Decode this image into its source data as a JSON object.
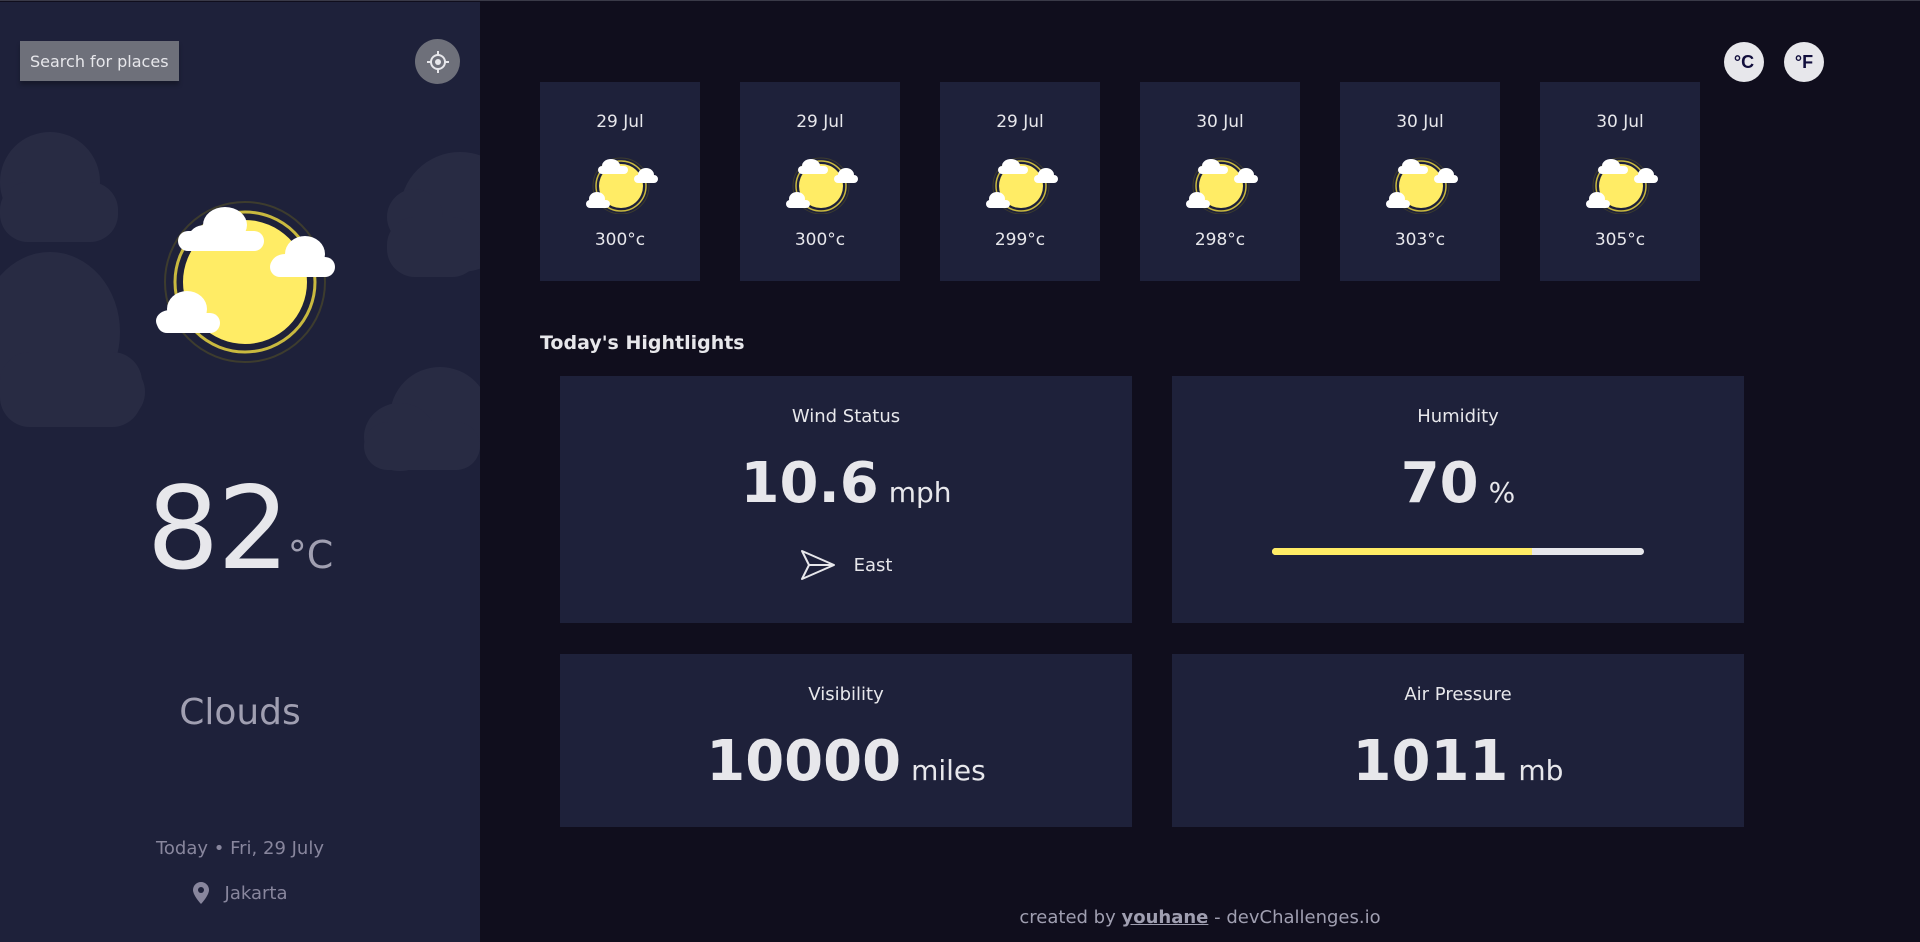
{
  "sidebar": {
    "search_label": "Search for places",
    "temperature": "82",
    "temperature_unit": "°C",
    "weather": "Clouds",
    "date": "Today • Fri, 29 July",
    "location": "Jakarta"
  },
  "units": {
    "celsius": "°C",
    "fahrenheit": "°F"
  },
  "forecast": [
    {
      "date": "29 Jul",
      "temp": "300°c",
      "icon": "partly-cloudy-sun-icon"
    },
    {
      "date": "29 Jul",
      "temp": "300°c",
      "icon": "partly-cloudy-sun-icon"
    },
    {
      "date": "29 Jul",
      "temp": "299°c",
      "icon": "partly-cloudy-sun-icon"
    },
    {
      "date": "30 Jul",
      "temp": "298°c",
      "icon": "partly-cloudy-sun-icon"
    },
    {
      "date": "30 Jul",
      "temp": "303°c",
      "icon": "partly-cloudy-sun-icon"
    },
    {
      "date": "30 Jul",
      "temp": "305°c",
      "icon": "partly-cloudy-sun-icon"
    }
  ],
  "highlights": {
    "title": "Today's Hightlights",
    "wind": {
      "title": "Wind Status",
      "value": "10.6",
      "unit": "mph",
      "direction": "East"
    },
    "humidity": {
      "title": "Humidity",
      "value": "70",
      "unit": "%",
      "percent": 70
    },
    "visibility": {
      "title": "Visibility",
      "value": "10000",
      "unit": "miles"
    },
    "pressure": {
      "title": "Air Pressure",
      "value": "1011",
      "unit": "mb"
    }
  },
  "footer": {
    "prefix": "created by",
    "author": "youhane",
    "suffix": "- devChallenges.io"
  },
  "colors": {
    "sidebar_bg": "#1e213a",
    "page_bg": "#100e1d",
    "sun": "#ffec65",
    "text": "#e7e7eb",
    "muted": "#a09fb1"
  }
}
